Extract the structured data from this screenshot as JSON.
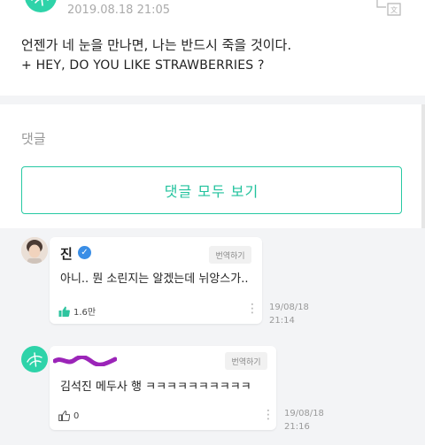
{
  "post": {
    "timestamp": "2019.08.18 21:05",
    "body_line1": "언젠가 네 눈을 만나면, 나는 반드시 죽을 것이다.",
    "body_line2": "+ HEY, DO YOU LIKE STRAWBERRIES ?"
  },
  "comments_section": {
    "label": "댓글",
    "view_all_label": "댓글 모두 보기"
  },
  "comments": [
    {
      "author": "진",
      "verified": true,
      "translate_label": "번역하기",
      "text": "아니.. 뭔 소린지는 알겠는데 뉘앙스가..",
      "likes": "1.6만",
      "date": "19/08/18",
      "time": "21:14"
    },
    {
      "author": "",
      "translate_label": "번역하기",
      "text": "김석진 메두사 행 ㅋㅋㅋㅋㅋㅋㅋㅋㅋㅋ",
      "likes": "0",
      "date": "19/08/18",
      "time": "21:16"
    }
  ],
  "colors": {
    "accent": "#27c9a3",
    "background": "#f3f4f6",
    "card": "#ffffff",
    "verified": "#3a8ee6",
    "redaction": "#9b24b8"
  },
  "icons": [
    "avatar-logo",
    "translate-icon",
    "verified-icon",
    "thumbs-up-icon",
    "more-icon"
  ]
}
